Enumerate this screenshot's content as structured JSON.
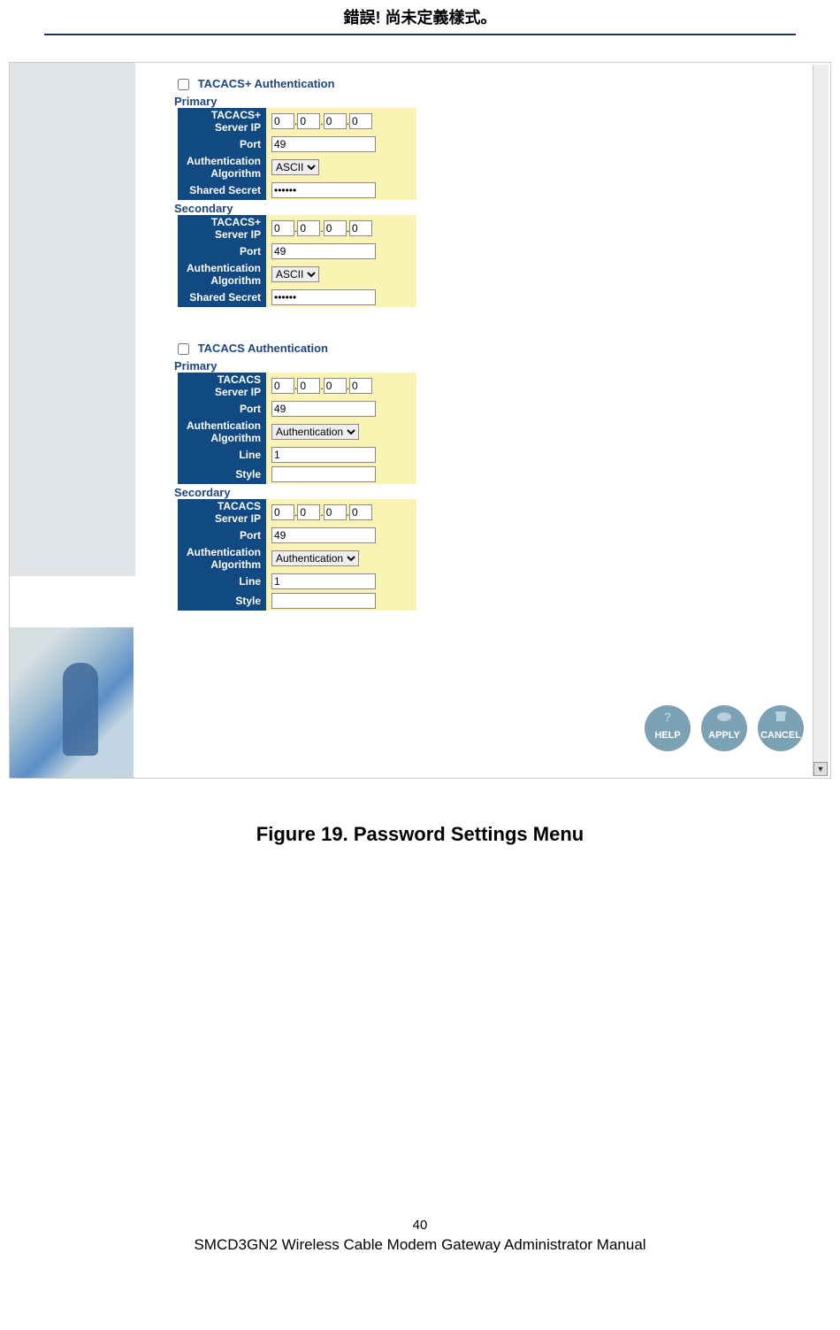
{
  "header": {
    "title": "錯誤! 尚未定義樣式。"
  },
  "tacacs_plus": {
    "title": "TACACS+ Authentication",
    "primary": {
      "heading": "Primary",
      "fields": {
        "server_ip_label": "TACACS+ Server IP",
        "ip": [
          "0",
          "0",
          "0",
          "0"
        ],
        "port_label": "Port",
        "port": "49",
        "auth_alg_label": "Authentication Algorithm",
        "auth_alg": "ASCII",
        "secret_label": "Shared Secret",
        "secret": "••••••"
      }
    },
    "secondary": {
      "heading": "Secondary",
      "fields": {
        "server_ip_label": "TACACS+ Server IP",
        "ip": [
          "0",
          "0",
          "0",
          "0"
        ],
        "port_label": "Port",
        "port": "49",
        "auth_alg_label": "Authentication Algorithm",
        "auth_alg": "ASCII",
        "secret_label": "Shared Secret",
        "secret": "••••••"
      }
    }
  },
  "tacacs": {
    "title": "TACACS Authentication",
    "primary": {
      "heading": "Primary",
      "fields": {
        "server_ip_label": "TACACS Server IP",
        "ip": [
          "0",
          "0",
          "0",
          "0"
        ],
        "port_label": "Port",
        "port": "49",
        "auth_alg_label": "Authentication Algorithm",
        "auth_alg": "Authentication",
        "line_label": "Line",
        "line": "1",
        "style_label": "Style",
        "style": ""
      }
    },
    "secondary": {
      "heading": "Secordary",
      "fields": {
        "server_ip_label": "TACACS Server IP",
        "ip": [
          "0",
          "0",
          "0",
          "0"
        ],
        "port_label": "Port",
        "port": "49",
        "auth_alg_label": "Authentication Algorithm",
        "auth_alg": "Authentication",
        "line_label": "Line",
        "line": "1",
        "style_label": "Style",
        "style": ""
      }
    }
  },
  "buttons": {
    "help": "HELP",
    "apply": "APPLY",
    "cancel": "CANCEL"
  },
  "caption": "Figure 19. Password Settings Menu",
  "page_number": "40",
  "footer": "SMCD3GN2 Wireless Cable Modem Gateway Administrator Manual"
}
